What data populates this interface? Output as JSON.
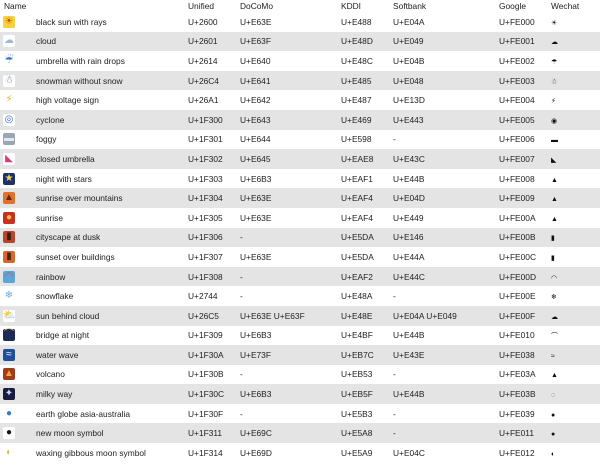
{
  "headers": [
    "Name",
    "Unified",
    "DoCoMo",
    "KDDI",
    "Softbank",
    "Google",
    "Wechat"
  ],
  "rows": [
    {
      "icon": "sun-icon",
      "glyph": "☀",
      "bg": "#f7d23a",
      "fg": "#c4560b",
      "name": "black sun with rays",
      "unified": "U+2600",
      "docomo": "U+E63E",
      "kddi": "U+E488",
      "softbank": "U+E04A",
      "google": "U+FE000",
      "wechat": "☀"
    },
    {
      "icon": "cloud-icon",
      "glyph": "☁",
      "bg": "#ffffff",
      "fg": "#9cb7d8",
      "name": "cloud",
      "unified": "U+2601",
      "docomo": "U+E63F",
      "kddi": "U+E48D",
      "softbank": "U+E049",
      "google": "U+FE001",
      "wechat": "☁"
    },
    {
      "icon": "umbrella-rain-icon",
      "glyph": "☔",
      "bg": "#ffffff",
      "fg": "#3a78c9",
      "name": "umbrella with rain drops",
      "unified": "U+2614",
      "docomo": "U+E640",
      "kddi": "U+E48C",
      "softbank": "U+E04B",
      "google": "U+FE002",
      "wechat": "☂"
    },
    {
      "icon": "snowman-icon",
      "glyph": "☃",
      "bg": "#ffffff",
      "fg": "#5a6f8a",
      "name": "snowman without snow",
      "unified": "U+26C4",
      "docomo": "U+E641",
      "kddi": "U+E485",
      "softbank": "U+E048",
      "google": "U+FE003",
      "wechat": "☃"
    },
    {
      "icon": "high-voltage-icon",
      "glyph": "⚡",
      "bg": "#ffffff",
      "fg": "#f2b21c",
      "name": "high voltage sign",
      "unified": "U+26A1",
      "docomo": "U+E642",
      "kddi": "U+E487",
      "softbank": "U+E13D",
      "google": "U+FE004",
      "wechat": "⚡"
    },
    {
      "icon": "cyclone-icon",
      "glyph": "◎",
      "bg": "#ffffff",
      "fg": "#2f6fc6",
      "name": "cyclone",
      "unified": "U+1F300",
      "docomo": "U+E643",
      "kddi": "U+E469",
      "softbank": "U+E443",
      "google": "U+FE005",
      "wechat": "◉"
    },
    {
      "icon": "foggy-icon",
      "glyph": "▬",
      "bg": "#9aa6b4",
      "fg": "#e3e8ee",
      "name": "foggy",
      "unified": "U+1F301",
      "docomo": "U+E644",
      "kddi": "U+E598",
      "softbank": "-",
      "google": "U+FE006",
      "wechat": "▬"
    },
    {
      "icon": "closed-umbrella-icon",
      "glyph": "◣",
      "bg": "#ffffff",
      "fg": "#d93a7a",
      "name": "closed umbrella",
      "unified": "U+1F302",
      "docomo": "U+E645",
      "kddi": "U+EAE8",
      "softbank": "U+E43C",
      "google": "U+FE007",
      "wechat": "◣"
    },
    {
      "icon": "night-stars-icon",
      "glyph": "★",
      "bg": "#1e2f6e",
      "fg": "#f1d651",
      "name": "night with stars",
      "unified": "U+1F303",
      "docomo": "U+E6B3",
      "kddi": "U+EAF1",
      "softbank": "U+E44B",
      "google": "U+FE008",
      "wechat": "▲"
    },
    {
      "icon": "sunrise-mountains-icon",
      "glyph": "▲",
      "bg": "#e0702a",
      "fg": "#5b2a10",
      "name": "sunrise over mountains",
      "unified": "U+1F304",
      "docomo": "U+E63E",
      "kddi": "U+EAF4",
      "softbank": "U+E04D",
      "google": "U+FE009",
      "wechat": "▲"
    },
    {
      "icon": "sunrise-icon",
      "glyph": "●",
      "bg": "#c8301f",
      "fg": "#f5c14a",
      "name": "sunrise",
      "unified": "U+1F305",
      "docomo": "U+E63E",
      "kddi": "U+EAF4",
      "softbank": "U+E449",
      "google": "U+FE00A",
      "wechat": "▲"
    },
    {
      "icon": "cityscape-dusk-icon",
      "glyph": "▮",
      "bg": "#b8452a",
      "fg": "#3b1a10",
      "name": "cityscape at dusk",
      "unified": "U+1F306",
      "docomo": "-",
      "kddi": "U+E5DA",
      "softbank": "U+E146",
      "google": "U+FE00B",
      "wechat": "▮"
    },
    {
      "icon": "sunset-buildings-icon",
      "glyph": "▮",
      "bg": "#d7682c",
      "fg": "#4b2010",
      "name": "sunset over buildings",
      "unified": "U+1F307",
      "docomo": "U+E63E",
      "kddi": "U+E5DA",
      "softbank": "U+E44A",
      "google": "U+FE00C",
      "wechat": "▮"
    },
    {
      "icon": "rainbow-icon",
      "glyph": "◠",
      "bg": "#5aa6d8",
      "fg": "#e8433a",
      "name": "rainbow",
      "unified": "U+1F308",
      "docomo": "-",
      "kddi": "U+EAF2",
      "softbank": "U+E44C",
      "google": "U+FE00D",
      "wechat": "◠"
    },
    {
      "icon": "snowflake-icon",
      "glyph": "❄",
      "bg": "#ffffff",
      "fg": "#74a9d8",
      "name": "snowflake",
      "unified": "U+2744",
      "docomo": "-",
      "kddi": "U+E48A",
      "softbank": "-",
      "google": "U+FE00E",
      "wechat": "❄"
    },
    {
      "icon": "sun-behind-cloud-icon",
      "glyph": "⛅",
      "bg": "#ffffff",
      "fg": "#e2a323",
      "name": "sun behind cloud",
      "unified": "U+26C5",
      "docomo": "U+E63E U+E63F",
      "kddi": "U+E48E",
      "softbank": "U+E04A U+E049",
      "google": "U+FE00F",
      "wechat": "☁"
    },
    {
      "icon": "bridge-night-icon",
      "glyph": "⌒",
      "bg": "#1d2a55",
      "fg": "#e8c24b",
      "name": "bridge at night",
      "unified": "U+1F309",
      "docomo": "U+E6B3",
      "kddi": "U+E4BF",
      "softbank": "U+E44B",
      "google": "U+FE010",
      "wechat": "⌒"
    },
    {
      "icon": "water-wave-icon",
      "glyph": "≈",
      "bg": "#1f4f9a",
      "fg": "#ffffff",
      "name": "water wave",
      "unified": "U+1F30A",
      "docomo": "U+E73F",
      "kddi": "U+EB7C",
      "softbank": "U+E43E",
      "google": "U+FE038",
      "wechat": "≈"
    },
    {
      "icon": "volcano-icon",
      "glyph": "▲",
      "bg": "#a23a1c",
      "fg": "#f3a43b",
      "name": "volcano",
      "unified": "U+1F30B",
      "docomo": "-",
      "kddi": "U+EB53",
      "softbank": "-",
      "google": "U+FE03A",
      "wechat": "▲"
    },
    {
      "icon": "milky-way-icon",
      "glyph": "✦",
      "bg": "#171c3d",
      "fg": "#c9d4ff",
      "name": "milky way",
      "unified": "U+1F30C",
      "docomo": "U+E6B3",
      "kddi": "U+EB5F",
      "softbank": "U+E44B",
      "google": "U+FE03B",
      "wechat": "◌"
    },
    {
      "icon": "earth-globe-icon",
      "glyph": "●",
      "bg": "#ffffff",
      "fg": "#2c7fc4",
      "name": "earth globe asia-australia",
      "unified": "U+1F30F",
      "docomo": "-",
      "kddi": "U+E5B3",
      "softbank": "-",
      "google": "U+FE039",
      "wechat": "●"
    },
    {
      "icon": "new-moon-icon",
      "glyph": "●",
      "bg": "#ffffff",
      "fg": "#141414",
      "name": "new moon symbol",
      "unified": "U+1F311",
      "docomo": "U+E69C",
      "kddi": "U+E5A8",
      "softbank": "-",
      "google": "U+FE011",
      "wechat": "●"
    },
    {
      "icon": "waxing-gibbous-moon-icon",
      "glyph": "◐",
      "bg": "#ffffff",
      "fg": "#d8c24a",
      "name": "waxing gibbous moon symbol",
      "unified": "U+1F314",
      "docomo": "U+E69D",
      "kddi": "U+E5A9",
      "softbank": "U+E04C",
      "google": "U+FE012",
      "wechat": "◐"
    }
  ]
}
